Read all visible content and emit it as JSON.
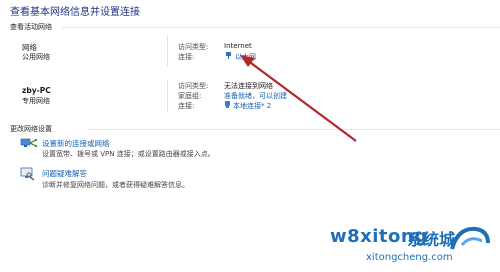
{
  "header": {
    "title": "查看基本网络信息并设置连接",
    "active_networks_label": "查看活动网络"
  },
  "networks": [
    {
      "name": "网络",
      "category": "公用网络",
      "access_type_key": "访问类型:",
      "access_type_value": "Internet",
      "connection_key": "连接:",
      "connection_value": "以太网"
    },
    {
      "name": "zby-PC",
      "category": "专用网络",
      "access_type_key": "访问类型:",
      "access_type_value": "无法连接到网络",
      "homegroup_key": "家庭组:",
      "homegroup_value": "准备就绪，可以创建",
      "connection_key": "连接:",
      "connection_value": "本地连接* 2"
    }
  ],
  "change_settings": {
    "label": "更改网络设置",
    "tasks": [
      {
        "title": "设置新的连接或网络",
        "description": "设置宽带、拨号或 VPN 连接；或设置路由器或接入点。",
        "icon": "network-setup-icon"
      },
      {
        "title": "问题疑难解答",
        "description": "诊断并修复网络问题，或者获得疑难解答信息。",
        "icon": "troubleshoot-icon"
      }
    ]
  },
  "watermark": {
    "brand_text": "w8xitong",
    "brand_cn": "系统城",
    "domain": "xitongcheng.com"
  },
  "colors": {
    "title": "#1e3287",
    "link": "#1a5fb4",
    "arrow": "#b3272d",
    "watermark_blue": "#1f6fb8"
  }
}
